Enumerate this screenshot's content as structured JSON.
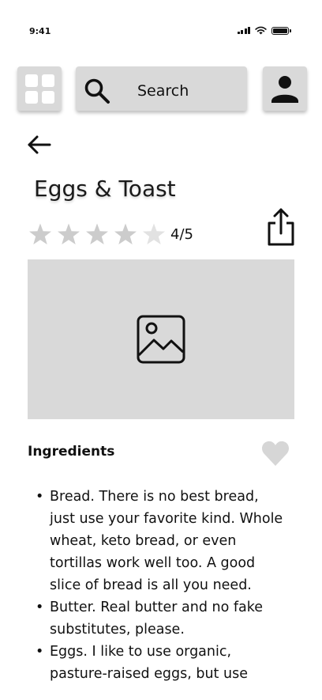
{
  "status_bar": {
    "time": "9:41"
  },
  "header": {
    "search_label": "Search",
    "icons": {
      "menu": "grid-icon",
      "search": "search-icon",
      "profile": "user-icon"
    }
  },
  "recipe": {
    "title": "Eggs & Toast",
    "rating": {
      "value": 4,
      "max": 5,
      "label": "4/5"
    },
    "image_placeholder_icon": "image-icon",
    "ingredients_heading": "Ingredients",
    "ingredients": [
      "Bread. There is no best bread, just use your favorite kind. Whole wheat, keto bread, or even tortillas work well too. A good slice of bread is all you need.",
      "Butter. Real butter and no fake substitutes, please.",
      "Eggs. I like to use organic, pasture-raised eggs, but use"
    ]
  },
  "colors": {
    "tile": "#d9d9d9",
    "star_filled": "#cccccc",
    "star_empty": "#e2e2e2",
    "heart": "#d6d6d6"
  }
}
